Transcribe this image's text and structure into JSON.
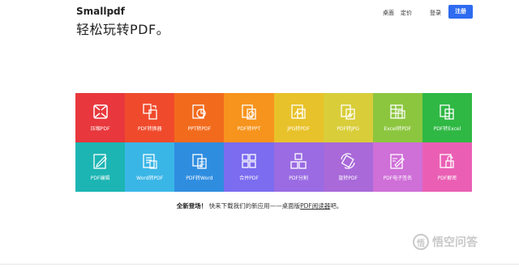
{
  "header": {
    "logo": "Smallpdf",
    "tagline": "轻松玩转PDF。",
    "nav": [
      {
        "label": "桌面"
      },
      {
        "label": "定价"
      },
      {
        "label": "登录"
      }
    ],
    "signup_label": "注册"
  },
  "tools": [
    {
      "label": "压缩PDF",
      "color": "#e8383d",
      "icon": "compress-icon"
    },
    {
      "label": "PDF转换器",
      "color": "#f04a2c",
      "icon": "convert-icon"
    },
    {
      "label": "PPT转PDF",
      "color": "#f26b1d",
      "icon": "ppt-icon"
    },
    {
      "label": "PDF转PPT",
      "color": "#f7941d",
      "icon": "pdf-ppt-icon"
    },
    {
      "label": "JPG转PDF",
      "color": "#e8c22a",
      "icon": "jpg-icon"
    },
    {
      "label": "PDF转JPG",
      "color": "#d9cd3a",
      "icon": "pdf-jpg-icon"
    },
    {
      "label": "Excel转PDF",
      "color": "#8cc63f",
      "icon": "excel-icon"
    },
    {
      "label": "PDF转Excel",
      "color": "#2fb844",
      "icon": "pdf-excel-icon"
    },
    {
      "label": "PDF编辑",
      "color": "#1cb5b3",
      "icon": "edit-icon"
    },
    {
      "label": "Word转PDF",
      "color": "#3ab6e6",
      "icon": "word-icon"
    },
    {
      "label": "PDF转Word",
      "color": "#2f8de0",
      "icon": "pdf-word-icon"
    },
    {
      "label": "合并PDF",
      "color": "#7b6cf0",
      "icon": "merge-icon"
    },
    {
      "label": "PDF分割",
      "color": "#9a6be3",
      "icon": "split-icon"
    },
    {
      "label": "旋转PDF",
      "color": "#a969d9",
      "icon": "rotate-icon"
    },
    {
      "label": "PDF电子签名",
      "color": "#cf6fd8",
      "icon": "sign-icon"
    },
    {
      "label": "PDF解密",
      "color": "#ea5fb4",
      "icon": "unlock-icon"
    }
  ],
  "promo": {
    "bold": "全新登场！",
    "text": "快来下载我们的新应用——桌面版",
    "link": "PDF阅读器",
    "suffix": "吧。"
  },
  "watermark": {
    "text": "悟空问答",
    "symbol": "悟"
  }
}
